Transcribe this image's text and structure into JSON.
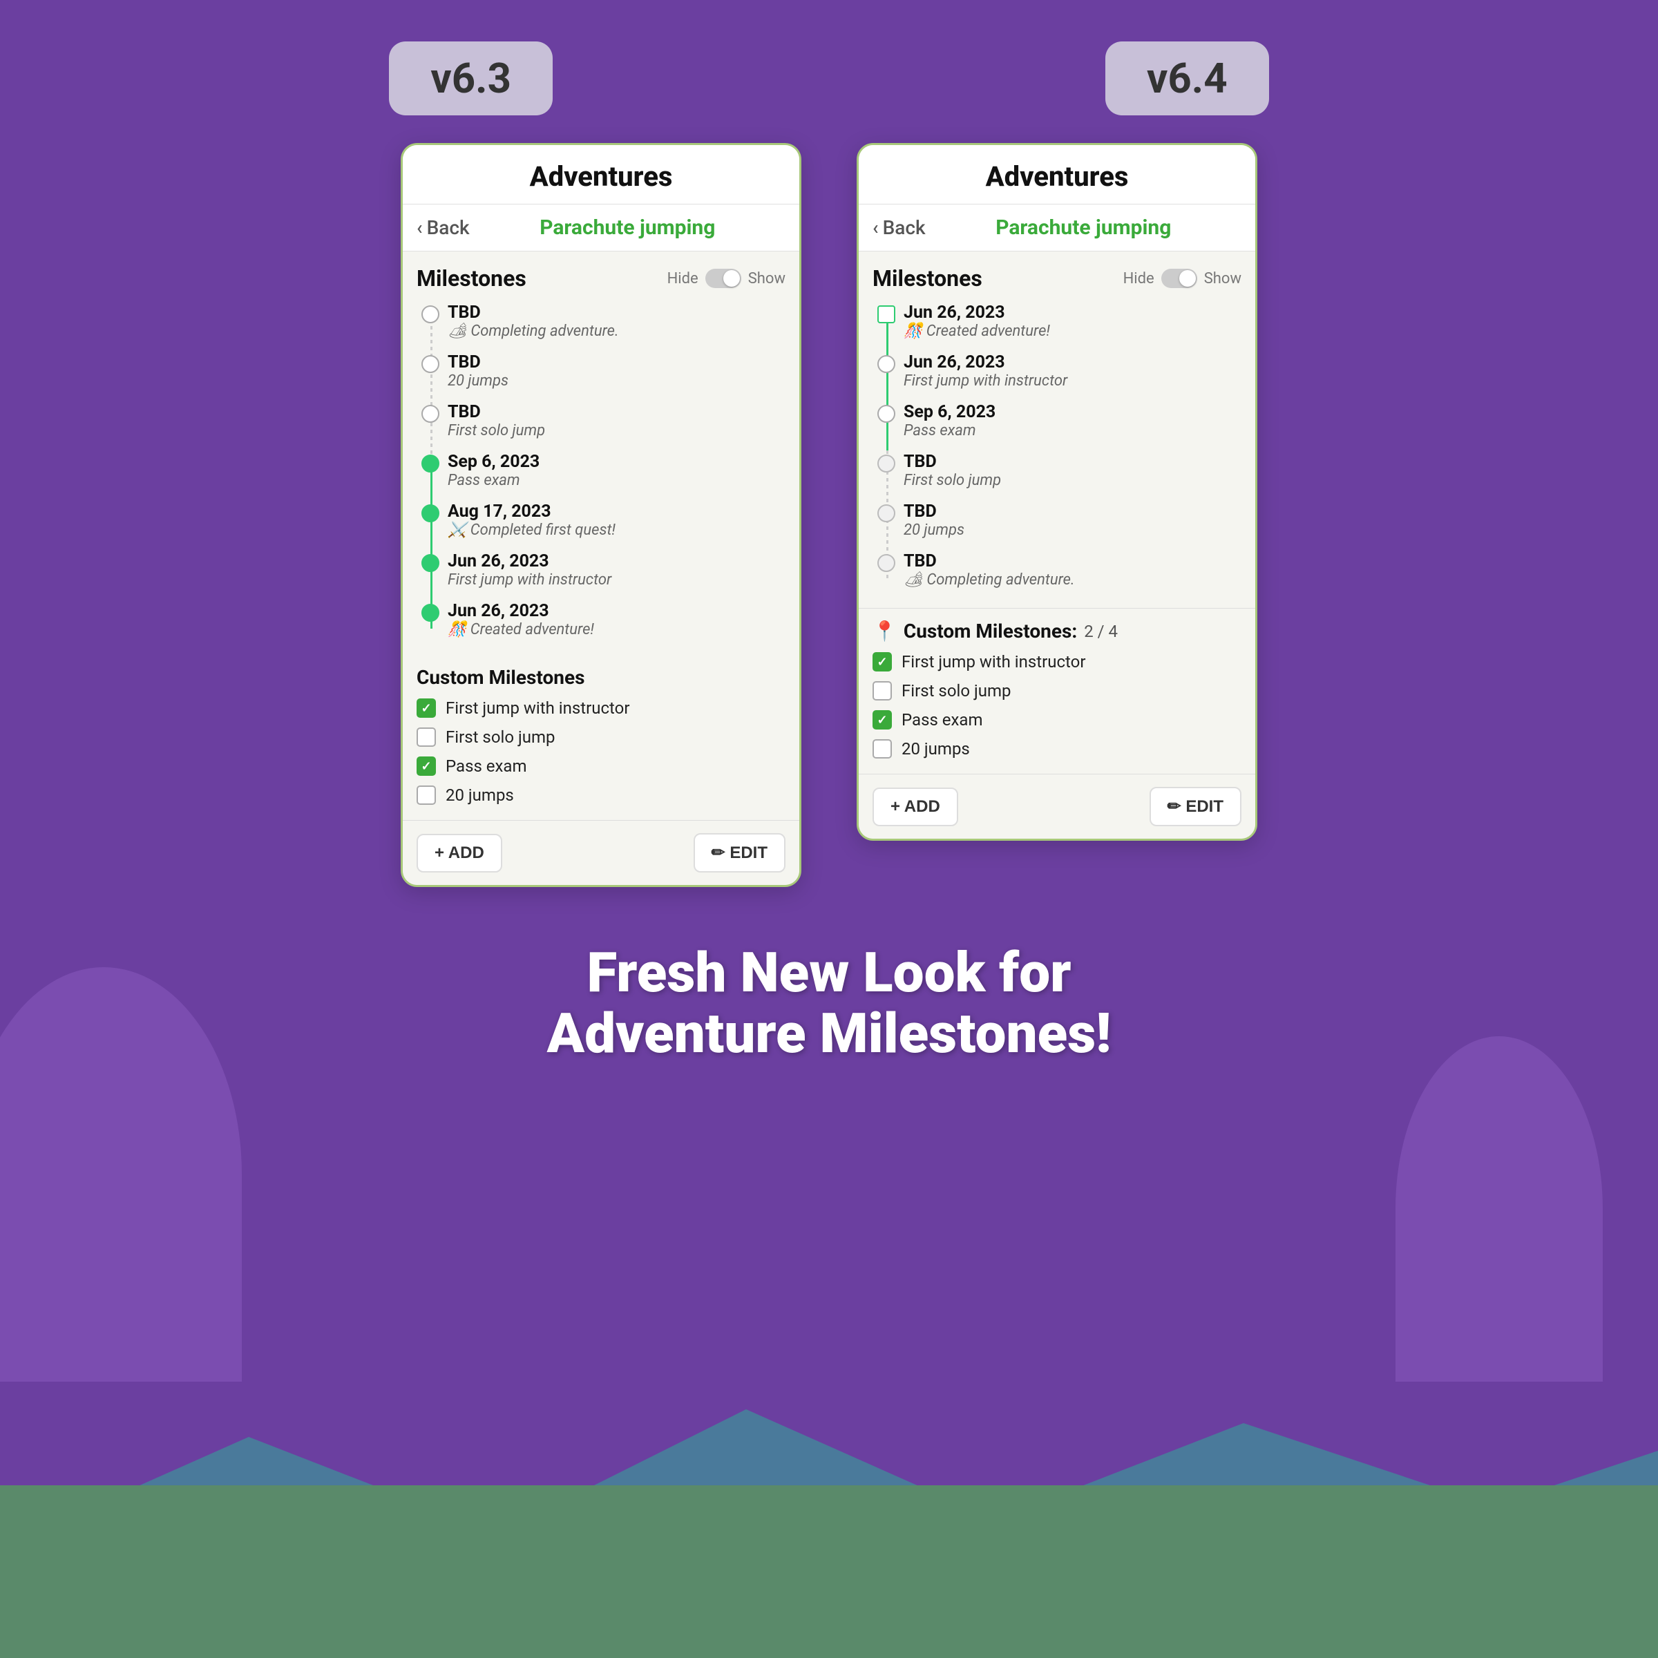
{
  "versions": {
    "left": "v6.3",
    "right": "v6.4"
  },
  "app": {
    "title": "Adventures",
    "nav": {
      "back_label": "Back",
      "page_title": "Parachute jumping"
    },
    "milestones_label": "Milestones",
    "toggle_hide": "Hide",
    "toggle_show": "Show"
  },
  "v63": {
    "milestones": [
      {
        "date": "TBD",
        "desc": "🏕 Completing adventure.",
        "filled": false
      },
      {
        "date": "TBD",
        "desc": "20 jumps",
        "filled": false
      },
      {
        "date": "TBD",
        "desc": "First solo jump",
        "filled": false
      },
      {
        "date": "Sep 6, 2023",
        "desc": "Pass exam",
        "filled": true
      },
      {
        "date": "Aug 17, 2023",
        "desc": "⚔️ Completed first quest!",
        "filled": true
      },
      {
        "date": "Jun 26, 2023",
        "desc": "First jump with instructor",
        "filled": true
      },
      {
        "date": "Jun 26, 2023",
        "desc": "🎊 Created adventure!",
        "filled": true
      }
    ],
    "custom_title": "Custom Milestones",
    "custom_items": [
      {
        "label": "First jump with instructor",
        "checked": true
      },
      {
        "label": "First solo jump",
        "checked": false
      },
      {
        "label": "Pass exam",
        "checked": true
      },
      {
        "label": "20 jumps",
        "checked": false
      }
    ],
    "add_label": "+ ADD",
    "edit_label": "✏ EDIT"
  },
  "v64": {
    "milestones": [
      {
        "date": "Jun 26, 2023",
        "desc": "🎊 Created adventure!",
        "type": "square"
      },
      {
        "date": "Jun 26, 2023",
        "desc": "First jump with instructor",
        "type": "circle-open"
      },
      {
        "date": "Sep 6, 2023",
        "desc": "Pass exam",
        "type": "circle-open"
      },
      {
        "date": "TBD",
        "desc": "First solo jump",
        "type": "circle-empty"
      },
      {
        "date": "TBD",
        "desc": "20 jumps",
        "type": "circle-empty"
      },
      {
        "date": "TBD",
        "desc": "🏕 Completing adventure.",
        "type": "circle-empty"
      }
    ],
    "custom_title": "Custom Milestones:",
    "custom_count": "2 / 4",
    "custom_items": [
      {
        "label": "First jump with instructor",
        "checked": true
      },
      {
        "label": "First solo jump",
        "checked": false
      },
      {
        "label": "Pass exam",
        "checked": true
      },
      {
        "label": "20 jumps",
        "checked": false
      }
    ],
    "add_label": "+ ADD",
    "edit_label": "✏ EDIT"
  },
  "bottom_text": "Fresh New Look for\nAdventure Milestones!"
}
